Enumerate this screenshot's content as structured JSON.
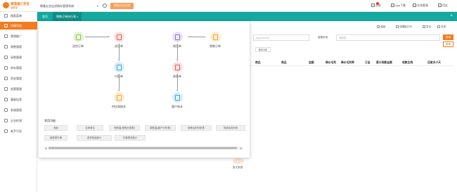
{
  "logo": {
    "name": "钢港通订货宝",
    "sub": "旗舰版"
  },
  "header": {
    "system_name": "缘隆五金店进销存管理系统",
    "dropdown_arrow": "▾",
    "system_button": "新版讨论交流",
    "links": [
      {
        "label": "消息",
        "icon": "bell-icon"
      },
      {
        "label": "App下载",
        "icon": "phone-icon"
      },
      {
        "label": "在线客服",
        "icon": "headset-icon"
      },
      {
        "label": "用友",
        "icon": "user-icon"
      }
    ]
  },
  "sidebar": {
    "items": [
      {
        "label": "搜索菜单",
        "icon": "search-icon"
      },
      {
        "label": "快捷导航",
        "icon": "compass-icon",
        "active": true
      },
      {
        "label": "营销推广",
        "icon": "megaphone-icon"
      },
      {
        "label": "销售管理",
        "icon": "cart-icon"
      },
      {
        "label": "采购管理",
        "icon": "truck-icon"
      },
      {
        "label": "库存管理",
        "icon": "box-icon"
      },
      {
        "label": "资金管理",
        "icon": "wallet-icon"
      },
      {
        "label": "经营管理",
        "icon": "chart-icon"
      },
      {
        "label": "基础信息",
        "icon": "database-icon"
      },
      {
        "label": "系统管理",
        "icon": "settings-icon"
      },
      {
        "label": "企业检测",
        "icon": "shield-icon"
      },
      {
        "label": "新手引导",
        "icon": "guide-icon"
      }
    ]
  },
  "tabs": [
    {
      "label": "首页"
    },
    {
      "label": "销售订单执行表",
      "close": "×",
      "active": true
    }
  ],
  "tabbar_close": "×",
  "background_page": {
    "toolbar": [
      {
        "label": "高级",
        "icon": "filter-icon"
      },
      {
        "label": "按模板打印",
        "icon": "printer-icon"
      },
      {
        "label": "导出",
        "icon": "export-icon"
      },
      {
        "label": "关闭",
        "icon": "close-icon"
      }
    ],
    "search_button": "查询",
    "reset_button": "重置",
    "date_placeholder": "yyyy-mm-dd",
    "status_label": "客服状态:",
    "status_placeholder": "请选择",
    "mini_tab": "库存分析",
    "columns": [
      "商品",
      "商品",
      "金额",
      "降价毛利",
      "降价毛利率",
      "订金",
      "累计收款金额",
      "收款比例",
      "还差多少天"
    ],
    "empty_text": "暂无数据"
  },
  "popup": {
    "flow_nodes": [
      {
        "label": "进货订单",
        "icon": "purchase-order-icon",
        "color": "#8cc63f",
        "bg": "#e3f3d2"
      },
      {
        "label": "进货单",
        "icon": "purchase-receipt-icon",
        "color": "#e05a4f",
        "bg": "#fbe0dd"
      },
      {
        "label": "付款单",
        "icon": "payment-icon",
        "color": "#36a4d8",
        "bg": "#d6eef9"
      },
      {
        "label": "供应商账本",
        "icon": "supplier-ledger-icon",
        "color": "#f5a623",
        "bg": "#fdeccf"
      },
      {
        "label": "销货单",
        "icon": "sales-receipt-icon",
        "color": "#8e6bd6",
        "bg": "#e8e0f8"
      },
      {
        "label": "销售订单",
        "icon": "sales-order-icon",
        "color": "#f5a623",
        "bg": "#fdeccf"
      },
      {
        "label": "收款单",
        "icon": "receipt-icon",
        "color": "#e05a4f",
        "bg": "#fbe0dd"
      },
      {
        "label": "客户账本",
        "icon": "customer-ledger-icon",
        "color": "#36a4d8",
        "bg": "#d6eef9"
      }
    ],
    "common_title": "常用功能:",
    "common_buttons": [
      "商品",
      "往来单位",
      "采购量(采购分类表)",
      "销售量(客户分布表)",
      "销售毛利分析表",
      "商品毛利分析",
      "销售排行榜",
      "进货商品统计",
      "付款情况统计"
    ],
    "scroll_left": "◂",
    "scroll_right": "▸"
  }
}
